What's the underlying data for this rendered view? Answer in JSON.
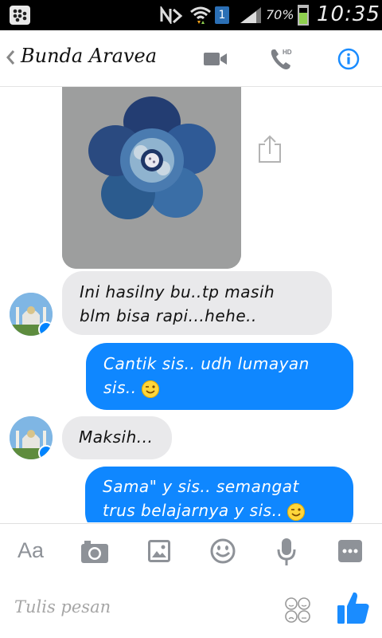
{
  "status_bar": {
    "sim_number": "1",
    "battery_percent": "70%",
    "battery_level": 0.7,
    "time": "10:35"
  },
  "header": {
    "contact_name": "Bunda Aravea",
    "accent_color": "#1a8cff"
  },
  "messages": [
    {
      "side": "incoming",
      "type": "image",
      "content": "crochet-flower-photo"
    },
    {
      "side": "incoming",
      "text_lines": [
        "Ini hasilny bu..tp masih",
        "blm bisa rapi...hehe.."
      ]
    },
    {
      "side": "outgoing",
      "text_lines": [
        "Cantik sis..  udh lumayan",
        "sis.."
      ],
      "emoji": "wink"
    },
    {
      "side": "incoming",
      "text_lines": [
        "Maksih..."
      ]
    },
    {
      "side": "outgoing",
      "text_lines": [
        "Sama\" y sis.. semangat",
        "trus belajarnya y sis.."
      ],
      "emoji": "wink"
    }
  ],
  "toolbar": {
    "text_format_label": "Aa",
    "icons": [
      "camera-icon",
      "gallery-icon",
      "sticker-icon",
      "microphone-icon",
      "more-icon"
    ]
  },
  "composer": {
    "placeholder": "Tulis pesan"
  }
}
